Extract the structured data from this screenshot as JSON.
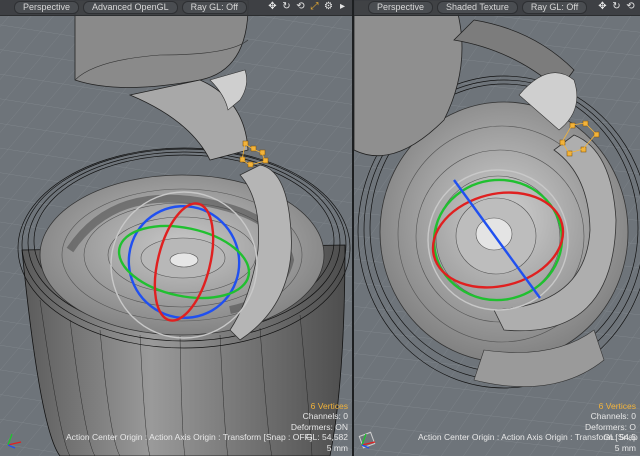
{
  "left_viewport": {
    "view_label": "Perspective",
    "shading_label": "Advanced OpenGL",
    "raygl_label": "Ray GL: Off",
    "hud": {
      "vertices": "6 Vertices",
      "channels": "Channels: 0",
      "deformers": "Deformers: ON",
      "gl": "GL: 54,582",
      "units": "5 mm"
    },
    "status_line": "Action Center Origin : Action Axis Origin : Transform  [Snap : OFF]"
  },
  "right_viewport": {
    "view_label": "Perspective",
    "shading_label": "Shaded Texture",
    "raygl_label": "Ray GL: Off",
    "hud": {
      "vertices": "6 Vertices",
      "channels": "Channels: 0",
      "deformers": "Deformers: O",
      "gl": "GL: 54,5",
      "units": "5 mm"
    },
    "status_line": "Action Center Origin : Action Axis Origin : Transform  [Snap : O"
  },
  "icons": [
    "move-view-icon",
    "rotate-view-icon",
    "reset-view-icon",
    "maximize-view-icon",
    "settings-gear-icon",
    "menu-arrow-icon"
  ],
  "colors": {
    "selection": "#f2b33a",
    "gizmo_x": "#e02020",
    "gizmo_y": "#20c030",
    "gizmo_z": "#2050f0",
    "viewport_bg": "#6e747a"
  }
}
